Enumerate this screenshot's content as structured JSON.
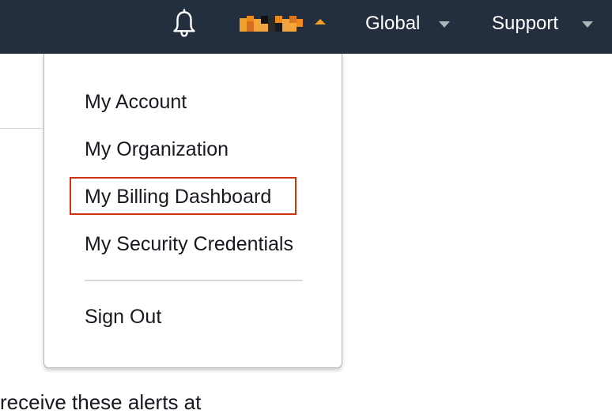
{
  "header": {
    "notifications_icon": "bell-icon",
    "account": {
      "redacted": true,
      "expanded": true,
      "caret_icon": "caret-up-icon"
    },
    "region_menu": {
      "label": "Global",
      "caret_icon": "caret-down-icon"
    },
    "support_menu": {
      "label": "Support",
      "caret_icon": "caret-down-icon"
    }
  },
  "account_dropdown": {
    "items": [
      {
        "label": "My Account"
      },
      {
        "label": "My Organization"
      },
      {
        "label": "My Billing Dashboard",
        "highlighted": true
      },
      {
        "label": "My Security Credentials"
      }
    ],
    "sign_out_label": "Sign Out"
  },
  "page": {
    "partial_text": "receive these alerts at"
  },
  "colors": {
    "header_background": "#232f3e",
    "account_caret": "#f0a025",
    "highlight_border": "#d13212",
    "text": "#16191f",
    "divider": "#d5dbdb"
  }
}
